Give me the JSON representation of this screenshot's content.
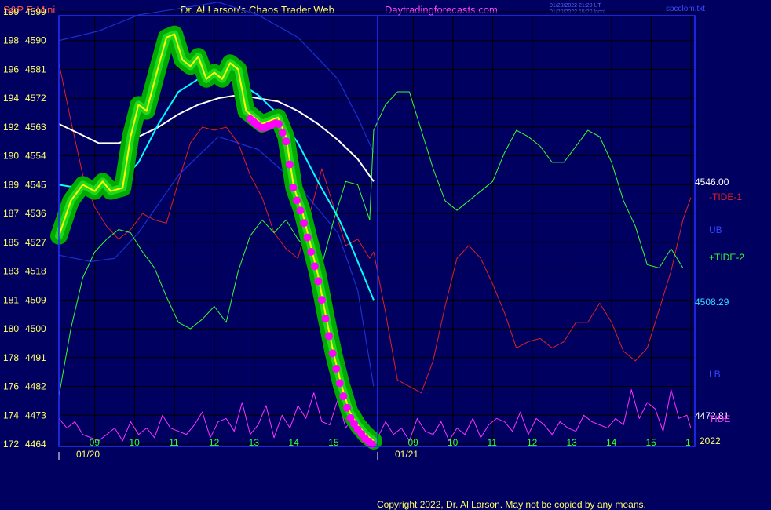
{
  "header": {
    "symbol": "S&P E-Mini",
    "title": "Dr. Al Larson's Chaos Trader Web",
    "site": "Daytradingforecasts.com",
    "stamp1": "01/20/2022 21:20 UT",
    "stamp2": "01/20/2022 15:20 local",
    "file": "spcclom.txt"
  },
  "copyright": "Copyright 2022, Dr. Al Larson. May not be copied by any means.",
  "colors": {
    "background": "#000060",
    "plot_border": "#2233ff",
    "grid": "#000000",
    "price_line": "#ffff00",
    "price_glow": "#00aa00",
    "price_glow_bright": "#33ff33",
    "dots": "#ff00ff",
    "ma_fast": "#00ffff",
    "ma_slow": "#ffffff",
    "band": "#1a2fd0",
    "tide_red": "#e02020",
    "tide_green": "#33ff33",
    "cycle": "#ff33ff",
    "axis_text": "#ffff66",
    "time_text": "#33ff33"
  },
  "chart_data": {
    "type": "line",
    "title": "S&P E-Mini",
    "y_axis_left": {
      "points_labels": [
        "199",
        "198",
        "196",
        "194",
        "192",
        "190",
        "189",
        "187",
        "185",
        "183",
        "181",
        "180",
        "178",
        "176",
        "174",
        "172"
      ],
      "price_labels": [
        "4599",
        "4590",
        "4581",
        "4572",
        "4563",
        "4554",
        "4545",
        "4536",
        "4527",
        "4518",
        "4509",
        "4500",
        "4491",
        "4482",
        "4473",
        "4464"
      ],
      "ylim": [
        4464,
        4599
      ]
    },
    "x_axis": {
      "hour_ticks_day1": [
        "09",
        "10",
        "11",
        "12",
        "13",
        "14",
        "15"
      ],
      "hour_ticks_day2": [
        "09",
        "10",
        "11",
        "12",
        "13",
        "14",
        "15",
        "1"
      ],
      "dates": [
        "01/20",
        "01/21"
      ],
      "year": "2022"
    },
    "right_labels": {
      "ub_value": "4546.00",
      "tide1": "-TIDE-1",
      "ub": "UB",
      "tide2": "+TIDE-2",
      "ma_value": "4508.29",
      "lb": "LB",
      "lb_value": "4472.81",
      "tide": "TIDE"
    },
    "series": [
      {
        "name": "price",
        "x": [
          0,
          0.3,
          0.6,
          0.9,
          1.1,
          1.3,
          1.6,
          1.8,
          2.0,
          2.2,
          2.5,
          2.7,
          2.9,
          3.1,
          3.3,
          3.5,
          3.7,
          3.9,
          4.1,
          4.3,
          4.5,
          4.7,
          4.9,
          5.1,
          5.3,
          5.5,
          5.7,
          5.9,
          6.1,
          6.3,
          6.5,
          6.7,
          6.9,
          7.1,
          7.3,
          7.5,
          7.7,
          7.9
        ],
        "values": [
          4529,
          4540,
          4545,
          4543,
          4546,
          4543,
          4544,
          4560,
          4570,
          4568,
          4582,
          4591,
          4592,
          4584,
          4582,
          4585,
          4578,
          4580,
          4578,
          4583,
          4581,
          4568,
          4566,
          4564,
          4565,
          4566,
          4560,
          4544,
          4537,
          4527,
          4517,
          4504,
          4492,
          4482,
          4474,
          4470,
          4467,
          4465
        ]
      },
      {
        "name": "ma_fast",
        "x": [
          0,
          0.5,
          1.0,
          1.5,
          2.0,
          2.5,
          3.0,
          3.5,
          4.0,
          4.5,
          5.0,
          5.5,
          6.0,
          6.5,
          7.0,
          7.3,
          7.6,
          7.9
        ],
        "values": [
          4545,
          4544,
          4543,
          4545,
          4552,
          4564,
          4574,
          4578,
          4579,
          4577,
          4573,
          4567,
          4558,
          4546,
          4535,
          4527,
          4518,
          4509
        ]
      },
      {
        "name": "ma_slow",
        "x": [
          0,
          0.5,
          1.0,
          1.5,
          2.0,
          2.5,
          3.0,
          3.5,
          4.0,
          4.5,
          5.0,
          5.5,
          6.0,
          6.5,
          7.0,
          7.5,
          7.9
        ],
        "values": [
          4564,
          4561,
          4558,
          4558,
          4560,
          4563,
          4567,
          4570,
          4572,
          4573,
          4572,
          4571,
          4568,
          4564,
          4559,
          4553,
          4546
        ]
      },
      {
        "name": "UB",
        "x": [
          0,
          1.0,
          2.0,
          3.0,
          4.0,
          5.0,
          6.0,
          7.0,
          7.5,
          7.9
        ],
        "values": [
          4590,
          4593,
          4598,
          4600,
          4602,
          4598,
          4591,
          4578,
          4566,
          4555
        ]
      },
      {
        "name": "LB",
        "x": [
          0,
          0.8,
          1.4,
          2.0,
          3.0,
          4.0,
          5.0,
          6.0,
          7.0,
          7.5,
          7.9
        ],
        "values": [
          4523,
          4521,
          4522,
          4530,
          4548,
          4560,
          4556,
          4545,
          4530,
          4512,
          4482
        ]
      },
      {
        "name": "-TIDE-1",
        "x": [
          0,
          0.3,
          0.6,
          0.9,
          1.2,
          1.5,
          1.8,
          2.1,
          2.4,
          2.7,
          3.0,
          3.3,
          3.6,
          3.9,
          4.2,
          4.5,
          4.8,
          5.1,
          5.4,
          5.7,
          6.0,
          6.3,
          6.6,
          6.9,
          7.2,
          7.5,
          7.8,
          7.9,
          8.2,
          8.5,
          8.8,
          9.1,
          9.4,
          9.7,
          10.0,
          10.3,
          10.6,
          10.9,
          11.2,
          11.5,
          11.8,
          12.1,
          12.4,
          12.7,
          13.0,
          13.3,
          13.6,
          13.9,
          14.2,
          14.5,
          14.8,
          15.1,
          15.4,
          15.7,
          15.9
        ],
        "values": [
          4583,
          4565,
          4548,
          4538,
          4532,
          4528,
          4531,
          4536,
          4534,
          4533,
          4546,
          4558,
          4563,
          4562,
          4563,
          4558,
          4548,
          4541,
          4530,
          4525,
          4522,
          4536,
          4550,
          4538,
          4526,
          4528,
          4522,
          4524,
          4505,
          4484,
          4482,
          4480,
          4490,
          4507,
          4522,
          4526,
          4522,
          4514,
          4505,
          4494,
          4496,
          4497,
          4494,
          4496,
          4502,
          4502,
          4508,
          4502,
          4493,
          4490,
          4494,
          4506,
          4518,
          4534,
          4541
        ]
      },
      {
        "name": "+TIDE-2",
        "x": [
          0,
          0.3,
          0.6,
          0.9,
          1.2,
          1.5,
          1.8,
          2.1,
          2.4,
          2.7,
          3.0,
          3.3,
          3.6,
          3.9,
          4.2,
          4.5,
          4.8,
          5.1,
          5.4,
          5.7,
          6.0,
          6.3,
          6.6,
          6.9,
          7.2,
          7.5,
          7.8,
          7.9,
          8.2,
          8.5,
          8.8,
          9.1,
          9.4,
          9.7,
          10.0,
          10.3,
          10.6,
          10.9,
          11.2,
          11.5,
          11.8,
          12.1,
          12.4,
          12.7,
          13.0,
          13.3,
          13.6,
          13.9,
          14.2,
          14.5,
          14.8,
          15.1,
          15.4,
          15.7,
          15.9
        ],
        "values": [
          4479,
          4500,
          4516,
          4524,
          4528,
          4531,
          4530,
          4524,
          4519,
          4510,
          4502,
          4500,
          4503,
          4507,
          4502,
          4518,
          4529,
          4534,
          4530,
          4534,
          4528,
          4524,
          4520,
          4534,
          4546,
          4545,
          4534,
          4562,
          4570,
          4574,
          4574,
          4562,
          4550,
          4540,
          4537,
          4540,
          4543,
          4546,
          4555,
          4562,
          4560,
          4557,
          4552,
          4552,
          4557,
          4562,
          4560,
          4552,
          4540,
          4532,
          4520,
          4519,
          4525,
          4519,
          4519
        ]
      },
      {
        "name": "TIDE",
        "x": [
          0,
          0.2,
          0.4,
          0.6,
          0.8,
          1.0,
          1.2,
          1.4,
          1.6,
          1.8,
          2.0,
          2.2,
          2.4,
          2.6,
          2.8,
          3.0,
          3.2,
          3.4,
          3.6,
          3.8,
          4.0,
          4.2,
          4.4,
          4.6,
          4.8,
          5.0,
          5.2,
          5.4,
          5.6,
          5.8,
          6.0,
          6.2,
          6.4,
          6.6,
          6.8,
          7.0,
          7.2,
          7.4,
          7.6,
          7.8,
          8.0,
          8.2,
          8.4,
          8.6,
          8.8,
          9.0,
          9.2,
          9.4,
          9.6,
          9.8,
          10.0,
          10.2,
          10.4,
          10.6,
          10.8,
          11.0,
          11.2,
          11.4,
          11.6,
          11.8,
          12.0,
          12.2,
          12.4,
          12.6,
          12.8,
          13.0,
          13.2,
          13.4,
          13.6,
          13.8,
          14.0,
          14.2,
          14.4,
          14.6,
          14.8,
          15.0,
          15.2,
          15.4,
          15.6,
          15.8,
          15.9
        ],
        "values": [
          4472,
          4469,
          4471,
          4467,
          4466,
          4465,
          4467,
          4469,
          4465,
          4471,
          4467,
          4469,
          4466,
          4473,
          4469,
          4468,
          4467,
          4470,
          4474,
          4466,
          4471,
          4472,
          4468,
          4477,
          4467,
          4470,
          4476,
          4466,
          4473,
          4469,
          4476,
          4472,
          4480,
          4471,
          4470,
          4478,
          4469,
          4473,
          4467,
          4465,
          4466,
          4471,
          4467,
          4469,
          4465,
          4472,
          4468,
          4467,
          4471,
          4465,
          4469,
          4467,
          4472,
          4466,
          4470,
          4472,
          4471,
          4468,
          4474,
          4467,
          4472,
          4470,
          4467,
          4471,
          4469,
          4468,
          4473,
          4471,
          4470,
          4469,
          4472,
          4470,
          4481,
          4472,
          4477,
          4475,
          4468,
          4481,
          4472,
          4473,
          4469
        ]
      }
    ],
    "dot_zone": {
      "x_start": 4.8,
      "x_end": 7.9
    }
  }
}
